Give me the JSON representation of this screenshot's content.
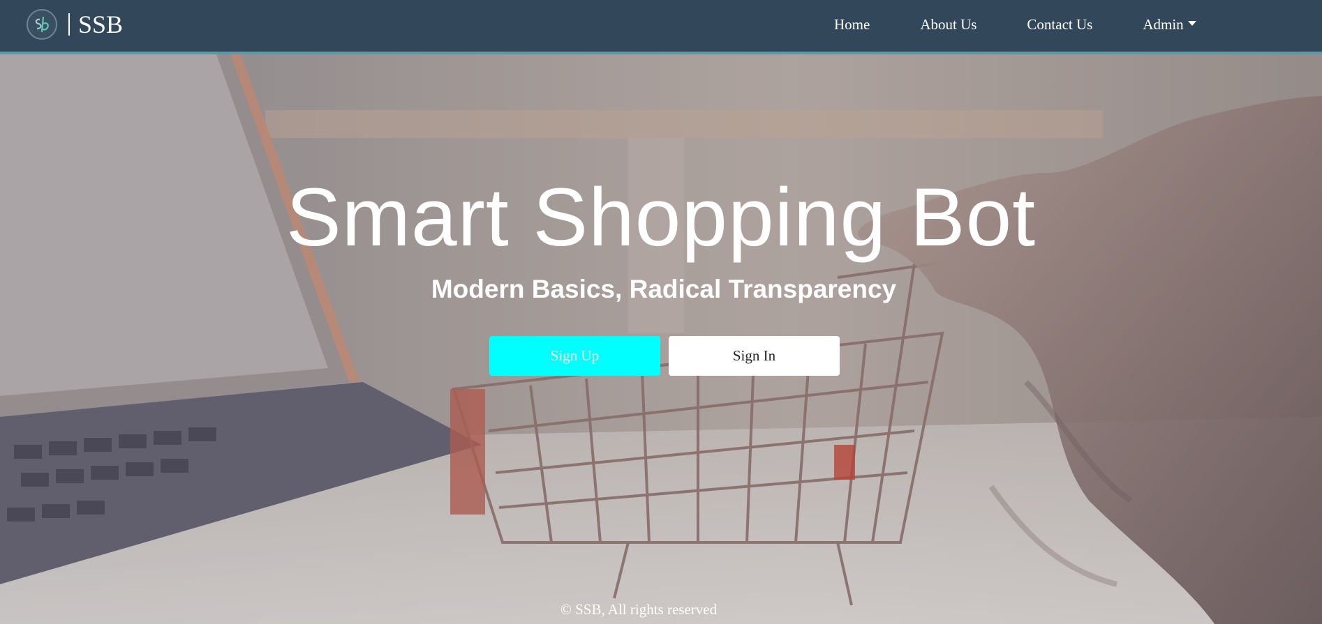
{
  "navbar": {
    "brand_name": "SSB",
    "links": [
      {
        "label": "Home"
      },
      {
        "label": "About Us"
      },
      {
        "label": "Contact Us"
      },
      {
        "label": "Admin"
      }
    ]
  },
  "hero": {
    "title": "Smart Shopping Bot",
    "subtitle": "Modern Basics, Radical Transparency",
    "signup_label": "Sign Up",
    "signin_label": "Sign In"
  },
  "footer": {
    "text": "© SSB, All rights reserved"
  },
  "colors": {
    "navbar_bg": "#33475b",
    "navbar_border": "#5e97a6",
    "signup_bg": "#00ffff",
    "signin_bg": "#ffffff"
  },
  "icons": {
    "logo": "ssb-logo-icon",
    "admin_caret": "caret-down-icon"
  }
}
